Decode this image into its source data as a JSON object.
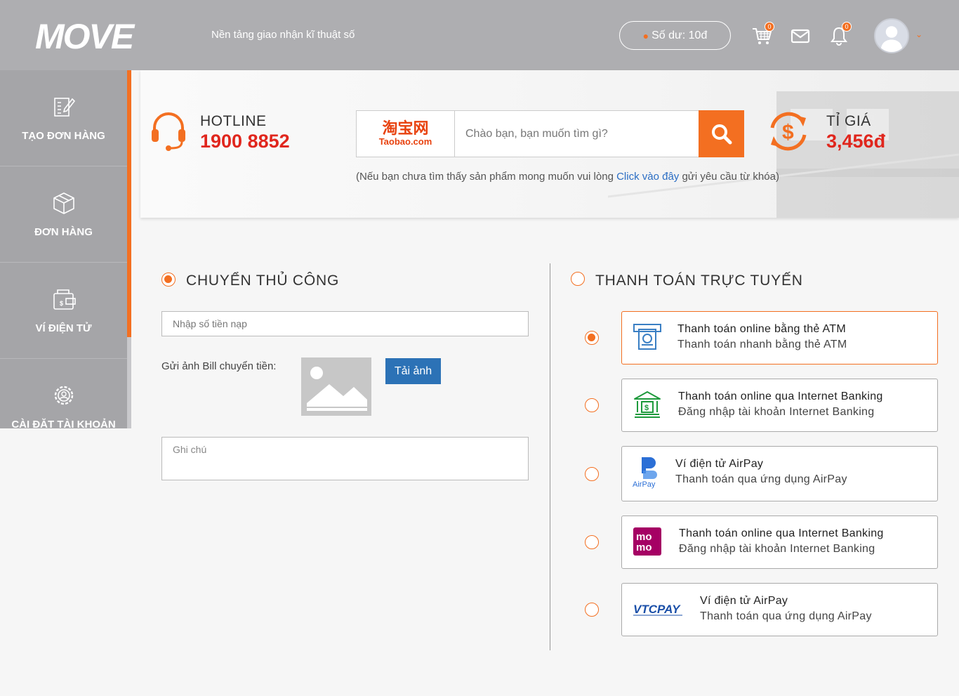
{
  "header": {
    "logo_text": "MOVE",
    "tagline": "Nền tảng giao nhận kĩ thuật số",
    "balance_label": "Số dư: 10đ",
    "cart_count": "0",
    "notification_count": "0"
  },
  "sidebar": {
    "items": [
      {
        "label": "TẠO ĐƠN HÀNG",
        "icon": "create-order-icon"
      },
      {
        "label": "ĐƠN HÀNG",
        "icon": "box-icon"
      },
      {
        "label": "VÍ ĐIỆN TỬ",
        "icon": "wallet-icon"
      },
      {
        "label": "CÀI ĐẶT TÀI KHOẢN",
        "icon": "settings-icon"
      }
    ]
  },
  "hero": {
    "hotline_label": "HOTLINE",
    "hotline_number": "1900 8852",
    "taobao_cn": "淘宝网",
    "taobao_en": "Taobao.com",
    "search_placeholder": "Chào bạn, bạn muốn tìm gì?",
    "hint_before": "(Nếu bạn chưa tìm thấy sản phẩm mong muốn vui lòng ",
    "hint_link": "Click vào đây",
    "hint_after": " gửi yêu cầu từ khóa)",
    "rate_label": "TỈ GIÁ",
    "rate_value": "3,456đ"
  },
  "manual": {
    "title": "CHUYỂN THỦ CÔNG",
    "selected": true,
    "amount_placeholder": "Nhập số tiền nạp",
    "bill_label": "Gửi ảnh Bill chuyển tiền:",
    "upload_label": "Tải ảnh",
    "note_placeholder": "Ghi chú"
  },
  "online": {
    "title": "THANH TOÁN TRỰC TUYẾN",
    "selected": false,
    "options": [
      {
        "title": "Thanh toán online bằng thẻ ATM",
        "subtitle": "Thanh toán nhanh bằng thẻ ATM",
        "icon": "atm-icon",
        "selected": true
      },
      {
        "title": "Thanh toán online qua Internet Banking",
        "subtitle": "Đăng nhập tài khoản Internet Banking",
        "icon": "bank-icon",
        "selected": false
      },
      {
        "title": "Ví điện tử AirPay",
        "subtitle": "Thanh toán qua ứng dụng AirPay",
        "icon": "airpay-icon",
        "icon_text": "AirPay",
        "selected": false
      },
      {
        "title": "Thanh toán online qua Internet Banking",
        "subtitle": "Đăng nhập tài khoản Internet Banking",
        "icon": "momo-icon",
        "icon_text": "mo mo",
        "selected": false
      },
      {
        "title": "Ví điện tử AirPay",
        "subtitle": "Thanh toán qua ứng dụng AirPay",
        "icon": "vtcpay-icon",
        "icon_text": "VTCPAY",
        "selected": false
      }
    ]
  },
  "colors": {
    "accent": "#f36f21",
    "header_bg": "#aeaeb1",
    "sidebar_bg": "#a5a5a8",
    "price_red": "#e0261d",
    "link_blue": "#2a6dc4",
    "button_blue": "#2c72b6"
  }
}
